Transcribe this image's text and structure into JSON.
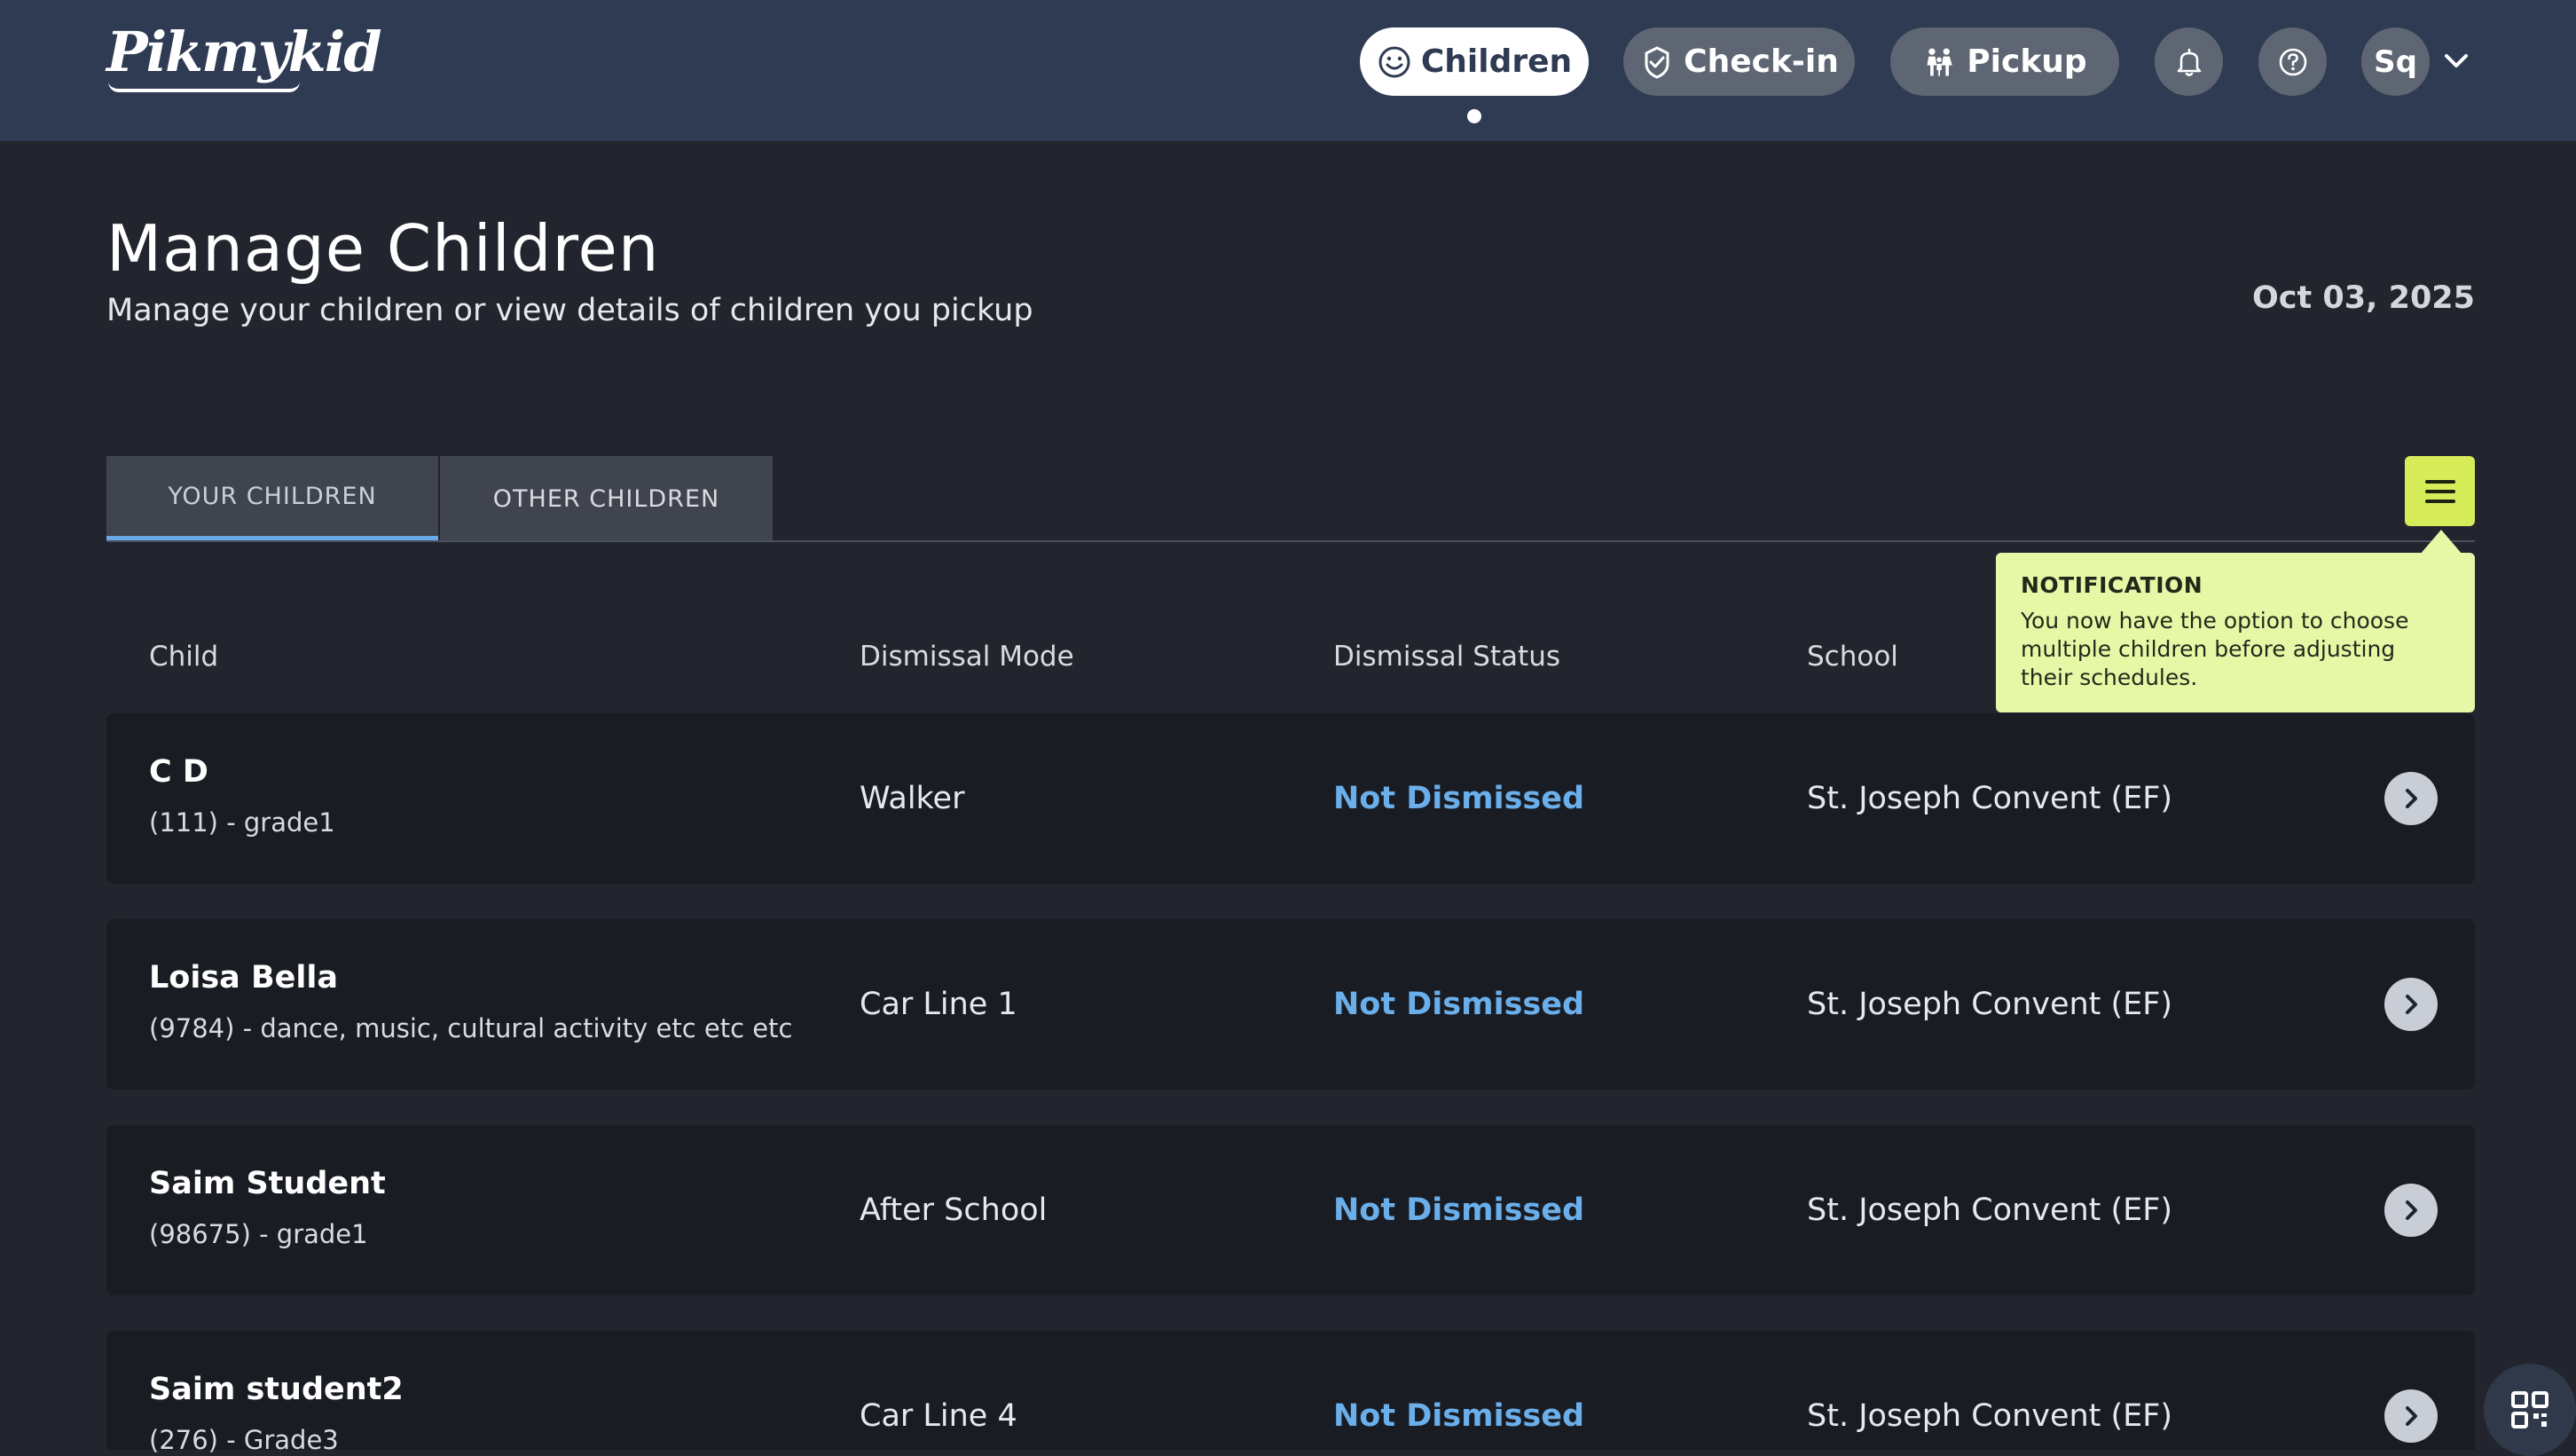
{
  "app": {
    "logo_text": "Pikmykid"
  },
  "nav": {
    "children_label": "Children",
    "checkin_label": "Check-in",
    "pickup_label": "Pickup",
    "avatar_initials": "Sq"
  },
  "page": {
    "title": "Manage Children",
    "subtitle": "Manage your children or view details of children you pickup",
    "date": "Oct 03, 2025"
  },
  "tabs": [
    {
      "label": "YOUR CHILDREN",
      "active": true
    },
    {
      "label": "OTHER CHILDREN",
      "active": false
    }
  ],
  "notification": {
    "title": "NOTIFICATION",
    "body": "You now have the option to choose multiple children before adjusting their schedules."
  },
  "table": {
    "headers": {
      "child": "Child",
      "mode": "Dismissal Mode",
      "status": "Dismissal Status",
      "school": "School"
    },
    "rows": [
      {
        "name": "C D",
        "meta": "(111) - grade1",
        "mode": "Walker",
        "status": "Not Dismissed",
        "school": "St. Joseph Convent (EF)"
      },
      {
        "name": "Loisa Bella",
        "meta": "(9784) - dance, music, cultural activity etc etc etc",
        "mode": "Car Line 1",
        "status": "Not Dismissed",
        "school": "St. Joseph Convent (EF)"
      },
      {
        "name": "Saim Student",
        "meta": "(98675) - grade1",
        "mode": "After School",
        "status": "Not Dismissed",
        "school": "St. Joseph Convent (EF)"
      },
      {
        "name": "Saim student2",
        "meta": "(276) - Grade3",
        "mode": "Car Line 4",
        "status": "Not Dismissed",
        "school": "St. Joseph Convent (EF)"
      }
    ]
  },
  "colors": {
    "topbar": "#2e3b52",
    "background": "#22252e",
    "row": "#191c23",
    "accent_status": "#6aaeea",
    "menu_button": "#d6ec59",
    "tooltip": "#e8f7a6"
  }
}
